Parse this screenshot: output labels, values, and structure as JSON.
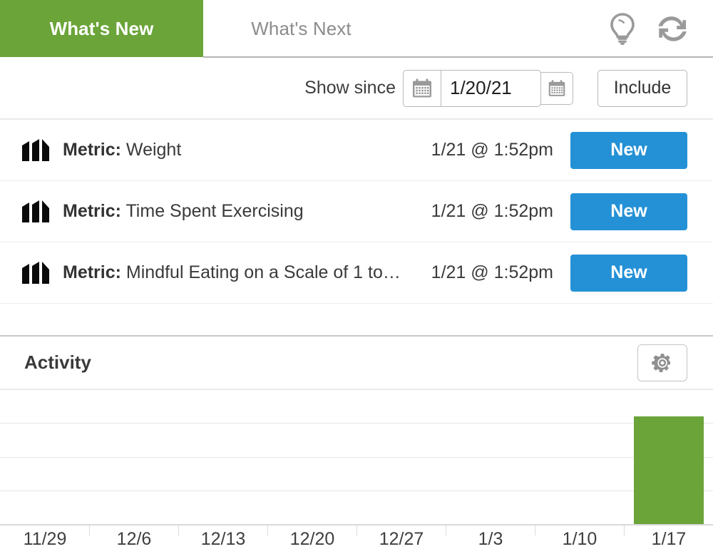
{
  "tabs": [
    {
      "label": "What's New",
      "active": true,
      "name": "tab-whats-new"
    },
    {
      "label": "What's Next",
      "active": false,
      "name": "tab-whats-next"
    }
  ],
  "header_icons": [
    {
      "name": "lightbulb-icon",
      "label": "Tips"
    },
    {
      "name": "refresh-icon",
      "label": "Refresh"
    }
  ],
  "filter": {
    "show_since_label": "Show since",
    "date_value": "1/20/21",
    "date_placeholder": "m/d/yy",
    "calendar_icon": "calendar-icon",
    "include_label": "Include"
  },
  "list": {
    "rows": [
      {
        "prefix": "Metric:",
        "title": "Weight",
        "time": "1/21 @ 1:52pm",
        "badge": "New",
        "icon": "bar-chart-icon"
      },
      {
        "prefix": "Metric:",
        "title": "Time Spent Exercising",
        "time": "1/21 @ 1:52pm",
        "badge": "New",
        "icon": "bar-chart-icon"
      },
      {
        "prefix": "Metric:",
        "title": "Mindful Eating on a Scale of 1 to…",
        "time": "1/21 @ 1:52pm",
        "badge": "New",
        "icon": "bar-chart-icon"
      }
    ]
  },
  "activity": {
    "title": "Activity",
    "settings_icon": "gear-icon"
  },
  "colors": {
    "brand_green": "#6ba539",
    "badge_blue": "#2491d6",
    "inactive_tab_text": "#8c8c8c",
    "grid": "#e6e6e6",
    "border": "#b9b9b9"
  },
  "chart_data": {
    "type": "bar",
    "title": "Activity",
    "categories": [
      "11/29",
      "12/6",
      "12/13",
      "12/20",
      "12/27",
      "1/3",
      "1/10",
      "1/17"
    ],
    "values": [
      0,
      0,
      0,
      0,
      0,
      0,
      0,
      4
    ],
    "xlabel": "",
    "ylabel": "",
    "ylim": [
      0,
      5
    ],
    "grid": true,
    "gridline_count": 4,
    "legend": "none",
    "series_color": "#6ba539"
  }
}
